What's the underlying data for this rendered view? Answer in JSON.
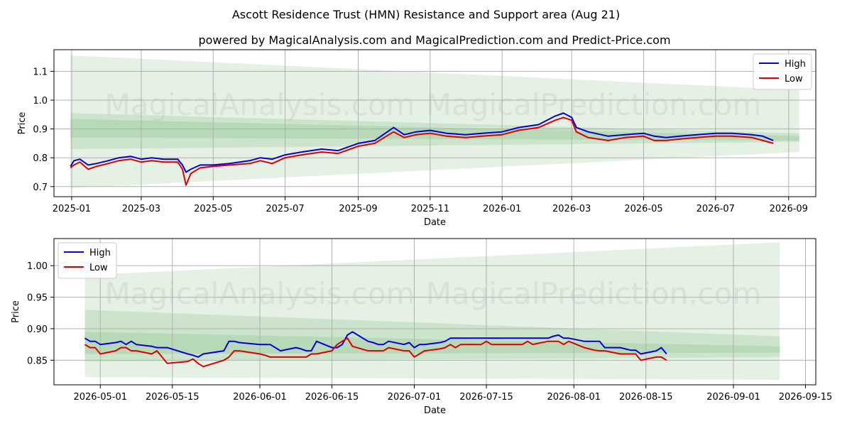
{
  "title": "Ascott Residence Trust (HMN) Resistance and Support area (Aug 21)",
  "subtitle": "powered by MagicalAnalysis.com and MagicalPrediction.com and Predict-Price.com",
  "watermarks": [
    "MagicalAnalysis.com",
    "MagicalPrediction.com"
  ],
  "colors": {
    "high": "#0000dd",
    "low": "#dd0000",
    "band": "#228b22",
    "grid": "#b0b0b0"
  },
  "chart_data": [
    {
      "type": "line",
      "xlabel": "Date",
      "ylabel": "Price",
      "xlim": [
        "2024-12-17",
        "2026-09-24"
      ],
      "ylim": [
        0.665,
        1.175
      ],
      "xticks": [
        "2025-01-01",
        "2025-03-01",
        "2025-05-01",
        "2025-07-01",
        "2025-09-01",
        "2025-11-01",
        "2026-01-01",
        "2026-03-01",
        "2026-05-01",
        "2026-07-01",
        "2026-09-01"
      ],
      "xtick_labels": [
        "2025-01",
        "2025-03",
        "2025-05",
        "2025-07",
        "2025-09",
        "2025-11",
        "2026-01",
        "2026-03",
        "2026-05",
        "2026-07",
        "2026-09"
      ],
      "yticks": [
        0.7,
        0.8,
        0.9,
        1.0,
        1.1
      ],
      "ytick_labels": [
        "0.7",
        "0.8",
        "0.9",
        "1.0",
        "1.1"
      ],
      "grid": true,
      "legend": "top-right",
      "bands": [
        {
          "x": [
            "2024-12-31",
            "2026-09-10"
          ],
          "upper": [
            1.155,
            1.035
          ],
          "lower": [
            0.695,
            0.82
          ]
        },
        {
          "x": [
            "2024-12-31",
            "2026-09-10"
          ],
          "upper": [
            0.955,
            0.885
          ],
          "lower": [
            0.83,
            0.855
          ]
        },
        {
          "x": [
            "2024-12-31",
            "2026-09-10"
          ],
          "upper": [
            0.935,
            0.875
          ],
          "lower": [
            0.87,
            0.86
          ]
        }
      ],
      "series": [
        {
          "name": "High",
          "color": "#0000dd",
          "x": [
            "2024-12-31",
            "2025-01-03",
            "2025-01-08",
            "2025-01-15",
            "2025-01-22",
            "2025-02-01",
            "2025-02-10",
            "2025-02-20",
            "2025-03-01",
            "2025-03-10",
            "2025-03-20",
            "2025-04-01",
            "2025-04-05",
            "2025-04-08",
            "2025-04-12",
            "2025-04-20",
            "2025-05-01",
            "2025-05-15",
            "2025-06-01",
            "2025-06-10",
            "2025-06-20",
            "2025-07-01",
            "2025-07-15",
            "2025-08-01",
            "2025-08-15",
            "2025-09-01",
            "2025-09-15",
            "2025-10-01",
            "2025-10-10",
            "2025-10-20",
            "2025-11-01",
            "2025-11-15",
            "2025-12-01",
            "2025-12-15",
            "2026-01-01",
            "2026-01-15",
            "2026-02-01",
            "2026-02-15",
            "2026-02-22",
            "2026-03-01",
            "2026-03-05",
            "2026-03-15",
            "2026-04-01",
            "2026-04-15",
            "2026-05-01",
            "2026-05-10",
            "2026-05-20",
            "2026-06-01",
            "2026-06-15",
            "2026-07-01",
            "2026-07-15",
            "2026-08-01",
            "2026-08-10",
            "2026-08-19"
          ],
          "values": [
            0.77,
            0.79,
            0.795,
            0.775,
            0.78,
            0.79,
            0.8,
            0.805,
            0.795,
            0.8,
            0.795,
            0.795,
            0.775,
            0.75,
            0.76,
            0.775,
            0.775,
            0.78,
            0.79,
            0.8,
            0.795,
            0.81,
            0.82,
            0.83,
            0.825,
            0.85,
            0.86,
            0.905,
            0.88,
            0.89,
            0.895,
            0.885,
            0.88,
            0.885,
            0.89,
            0.905,
            0.915,
            0.945,
            0.955,
            0.94,
            0.905,
            0.89,
            0.875,
            0.88,
            0.885,
            0.875,
            0.87,
            0.875,
            0.88,
            0.885,
            0.885,
            0.88,
            0.875,
            0.86
          ]
        },
        {
          "name": "Low",
          "color": "#dd0000",
          "x": [
            "2024-12-31",
            "2025-01-03",
            "2025-01-08",
            "2025-01-15",
            "2025-01-22",
            "2025-02-01",
            "2025-02-10",
            "2025-02-20",
            "2025-03-01",
            "2025-03-10",
            "2025-03-20",
            "2025-04-01",
            "2025-04-05",
            "2025-04-08",
            "2025-04-12",
            "2025-04-20",
            "2025-05-01",
            "2025-05-15",
            "2025-06-01",
            "2025-06-10",
            "2025-06-20",
            "2025-07-01",
            "2025-07-15",
            "2025-08-01",
            "2025-08-15",
            "2025-09-01",
            "2025-09-15",
            "2025-10-01",
            "2025-10-10",
            "2025-10-20",
            "2025-11-01",
            "2025-11-15",
            "2025-12-01",
            "2025-12-15",
            "2026-01-01",
            "2026-01-15",
            "2026-02-01",
            "2026-02-15",
            "2026-02-22",
            "2026-03-01",
            "2026-03-05",
            "2026-03-15",
            "2026-04-01",
            "2026-04-15",
            "2026-05-01",
            "2026-05-10",
            "2026-05-20",
            "2026-06-01",
            "2026-06-15",
            "2026-07-01",
            "2026-07-15",
            "2026-08-01",
            "2026-08-10",
            "2026-08-19"
          ],
          "values": [
            0.765,
            0.775,
            0.785,
            0.76,
            0.77,
            0.78,
            0.79,
            0.795,
            0.785,
            0.79,
            0.785,
            0.785,
            0.76,
            0.705,
            0.745,
            0.765,
            0.77,
            0.775,
            0.78,
            0.79,
            0.78,
            0.8,
            0.81,
            0.82,
            0.815,
            0.84,
            0.85,
            0.89,
            0.87,
            0.88,
            0.885,
            0.875,
            0.87,
            0.875,
            0.88,
            0.895,
            0.905,
            0.93,
            0.94,
            0.93,
            0.89,
            0.87,
            0.86,
            0.87,
            0.875,
            0.86,
            0.86,
            0.865,
            0.87,
            0.875,
            0.875,
            0.87,
            0.86,
            0.85
          ]
        }
      ]
    },
    {
      "type": "line",
      "xlabel": "Date",
      "ylabel": "Price",
      "xlim": [
        "2026-04-22",
        "2026-09-17"
      ],
      "ylim": [
        0.811,
        1.043
      ],
      "xticks": [
        "2026-05-01",
        "2026-05-15",
        "2026-06-01",
        "2026-06-15",
        "2026-07-01",
        "2026-07-15",
        "2026-08-01",
        "2026-08-15",
        "2026-09-01",
        "2026-09-15"
      ],
      "xtick_labels": [
        "2026-05-01",
        "2026-05-15",
        "2026-06-01",
        "2026-06-15",
        "2026-07-01",
        "2026-07-15",
        "2026-08-01",
        "2026-08-15",
        "2026-09-01",
        "2026-09-15"
      ],
      "yticks": [
        0.85,
        0.9,
        0.95,
        1.0
      ],
      "ytick_labels": [
        "0.85",
        "0.90",
        "0.95",
        "1.00"
      ],
      "grid": true,
      "legend": "top-left",
      "bands": [
        {
          "x": [
            "2026-04-28",
            "2026-09-10"
          ],
          "upper": [
            0.985,
            1.037
          ],
          "lower": [
            0.823,
            0.819
          ]
        },
        {
          "x": [
            "2026-04-28",
            "2026-09-10"
          ],
          "upper": [
            0.93,
            0.888
          ],
          "lower": [
            0.848,
            0.855
          ]
        },
        {
          "x": [
            "2026-04-28",
            "2026-09-10"
          ],
          "upper": [
            0.895,
            0.872
          ],
          "lower": [
            0.86,
            0.862
          ]
        }
      ],
      "series": [
        {
          "name": "High",
          "color": "#0000dd",
          "x": [
            "2026-04-28",
            "2026-04-29",
            "2026-04-30",
            "2026-05-01",
            "2026-05-04",
            "2026-05-05",
            "2026-05-06",
            "2026-05-07",
            "2026-05-08",
            "2026-05-11",
            "2026-05-12",
            "2026-05-13",
            "2026-05-14",
            "2026-05-18",
            "2026-05-19",
            "2026-05-20",
            "2026-05-21",
            "2026-05-25",
            "2026-05-26",
            "2026-05-27",
            "2026-05-28",
            "2026-06-01",
            "2026-06-02",
            "2026-06-03",
            "2026-06-04",
            "2026-06-05",
            "2026-06-08",
            "2026-06-09",
            "2026-06-10",
            "2026-06-11",
            "2026-06-12",
            "2026-06-15",
            "2026-06-16",
            "2026-06-17",
            "2026-06-18",
            "2026-06-19",
            "2026-06-22",
            "2026-06-23",
            "2026-06-24",
            "2026-06-25",
            "2026-06-26",
            "2026-06-29",
            "2026-06-30",
            "2026-07-01",
            "2026-07-02",
            "2026-07-03",
            "2026-07-06",
            "2026-07-07",
            "2026-07-08",
            "2026-07-09",
            "2026-07-10",
            "2026-07-13",
            "2026-07-14",
            "2026-07-15",
            "2026-07-16",
            "2026-07-17",
            "2026-07-20",
            "2026-07-21",
            "2026-07-22",
            "2026-07-23",
            "2026-07-24",
            "2026-07-27",
            "2026-07-28",
            "2026-07-29",
            "2026-07-30",
            "2026-07-31",
            "2026-08-03",
            "2026-08-04",
            "2026-08-05",
            "2026-08-06",
            "2026-08-07",
            "2026-08-10",
            "2026-08-11",
            "2026-08-12",
            "2026-08-13",
            "2026-08-14",
            "2026-08-17",
            "2026-08-18",
            "2026-08-19"
          ],
          "values": [
            0.885,
            0.88,
            0.88,
            0.875,
            0.878,
            0.88,
            0.875,
            0.88,
            0.875,
            0.872,
            0.87,
            0.87,
            0.87,
            0.86,
            0.858,
            0.855,
            0.86,
            0.865,
            0.88,
            0.88,
            0.878,
            0.875,
            0.875,
            0.875,
            0.87,
            0.865,
            0.87,
            0.868,
            0.865,
            0.865,
            0.88,
            0.87,
            0.87,
            0.875,
            0.89,
            0.895,
            0.88,
            0.878,
            0.875,
            0.875,
            0.88,
            0.875,
            0.878,
            0.87,
            0.875,
            0.875,
            0.878,
            0.88,
            0.885,
            0.885,
            0.885,
            0.885,
            0.885,
            0.885,
            0.885,
            0.885,
            0.885,
            0.885,
            0.885,
            0.885,
            0.885,
            0.885,
            0.888,
            0.89,
            0.885,
            0.885,
            0.88,
            0.88,
            0.88,
            0.88,
            0.87,
            0.87,
            0.868,
            0.866,
            0.866,
            0.86,
            0.865,
            0.87,
            0.86
          ]
        },
        {
          "name": "Low",
          "color": "#dd0000",
          "x": [
            "2026-04-28",
            "2026-04-29",
            "2026-04-30",
            "2026-05-01",
            "2026-05-04",
            "2026-05-05",
            "2026-05-06",
            "2026-05-07",
            "2026-05-08",
            "2026-05-11",
            "2026-05-12",
            "2026-05-13",
            "2026-05-14",
            "2026-05-18",
            "2026-05-19",
            "2026-05-20",
            "2026-05-21",
            "2026-05-25",
            "2026-05-26",
            "2026-05-27",
            "2026-05-28",
            "2026-06-01",
            "2026-06-02",
            "2026-06-03",
            "2026-06-04",
            "2026-06-05",
            "2026-06-08",
            "2026-06-09",
            "2026-06-10",
            "2026-06-11",
            "2026-06-12",
            "2026-06-15",
            "2026-06-16",
            "2026-06-17",
            "2026-06-18",
            "2026-06-19",
            "2026-06-22",
            "2026-06-23",
            "2026-06-24",
            "2026-06-25",
            "2026-06-26",
            "2026-06-29",
            "2026-06-30",
            "2026-07-01",
            "2026-07-02",
            "2026-07-03",
            "2026-07-06",
            "2026-07-07",
            "2026-07-08",
            "2026-07-09",
            "2026-07-10",
            "2026-07-13",
            "2026-07-14",
            "2026-07-15",
            "2026-07-16",
            "2026-07-17",
            "2026-07-20",
            "2026-07-21",
            "2026-07-22",
            "2026-07-23",
            "2026-07-24",
            "2026-07-27",
            "2026-07-28",
            "2026-07-29",
            "2026-07-30",
            "2026-07-31",
            "2026-08-03",
            "2026-08-04",
            "2026-08-05",
            "2026-08-06",
            "2026-08-07",
            "2026-08-10",
            "2026-08-11",
            "2026-08-12",
            "2026-08-13",
            "2026-08-14",
            "2026-08-17",
            "2026-08-18",
            "2026-08-19"
          ],
          "values": [
            0.875,
            0.87,
            0.87,
            0.86,
            0.865,
            0.87,
            0.87,
            0.865,
            0.865,
            0.86,
            0.865,
            0.855,
            0.845,
            0.848,
            0.852,
            0.845,
            0.84,
            0.85,
            0.855,
            0.865,
            0.865,
            0.86,
            0.858,
            0.855,
            0.855,
            0.855,
            0.855,
            0.855,
            0.855,
            0.86,
            0.86,
            0.865,
            0.875,
            0.88,
            0.885,
            0.872,
            0.865,
            0.865,
            0.865,
            0.865,
            0.87,
            0.865,
            0.865,
            0.855,
            0.86,
            0.865,
            0.868,
            0.87,
            0.875,
            0.87,
            0.875,
            0.875,
            0.875,
            0.88,
            0.875,
            0.875,
            0.875,
            0.875,
            0.875,
            0.88,
            0.875,
            0.88,
            0.88,
            0.88,
            0.875,
            0.88,
            0.87,
            0.868,
            0.866,
            0.865,
            0.865,
            0.86,
            0.86,
            0.86,
            0.86,
            0.85,
            0.855,
            0.855,
            0.85
          ]
        }
      ]
    }
  ]
}
